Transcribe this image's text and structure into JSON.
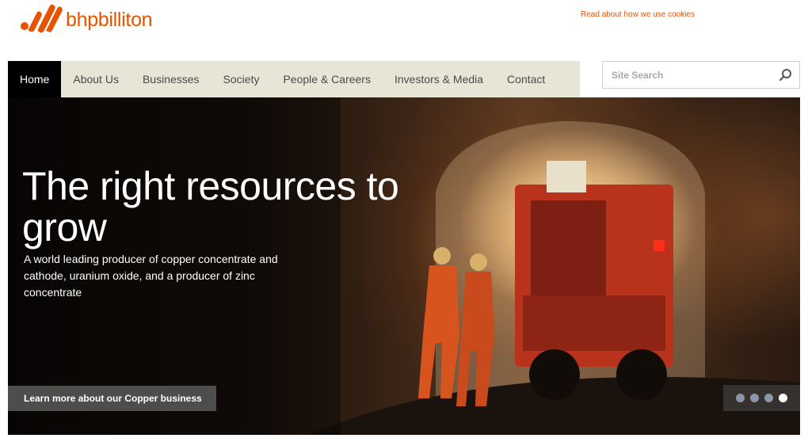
{
  "brand": {
    "name": "bhpbilliton",
    "color": "#e65400"
  },
  "header": {
    "cookie_link": "Read about how we use cookies"
  },
  "nav": {
    "items": [
      {
        "label": "Home",
        "active": true
      },
      {
        "label": "About Us"
      },
      {
        "label": "Businesses"
      },
      {
        "label": "Society"
      },
      {
        "label": "People & Careers"
      },
      {
        "label": "Investors & Media"
      },
      {
        "label": "Contact"
      }
    ]
  },
  "search": {
    "placeholder": "Site Search",
    "icon": "search-icon"
  },
  "hero": {
    "title": "The right resources to grow",
    "subtitle": "A world leading producer of copper concentrate and cathode, uranium oxide, and a producer of zinc concentrate",
    "cta": "Learn more about our Copper business",
    "slides_total": 4,
    "active_slide": 4
  }
}
